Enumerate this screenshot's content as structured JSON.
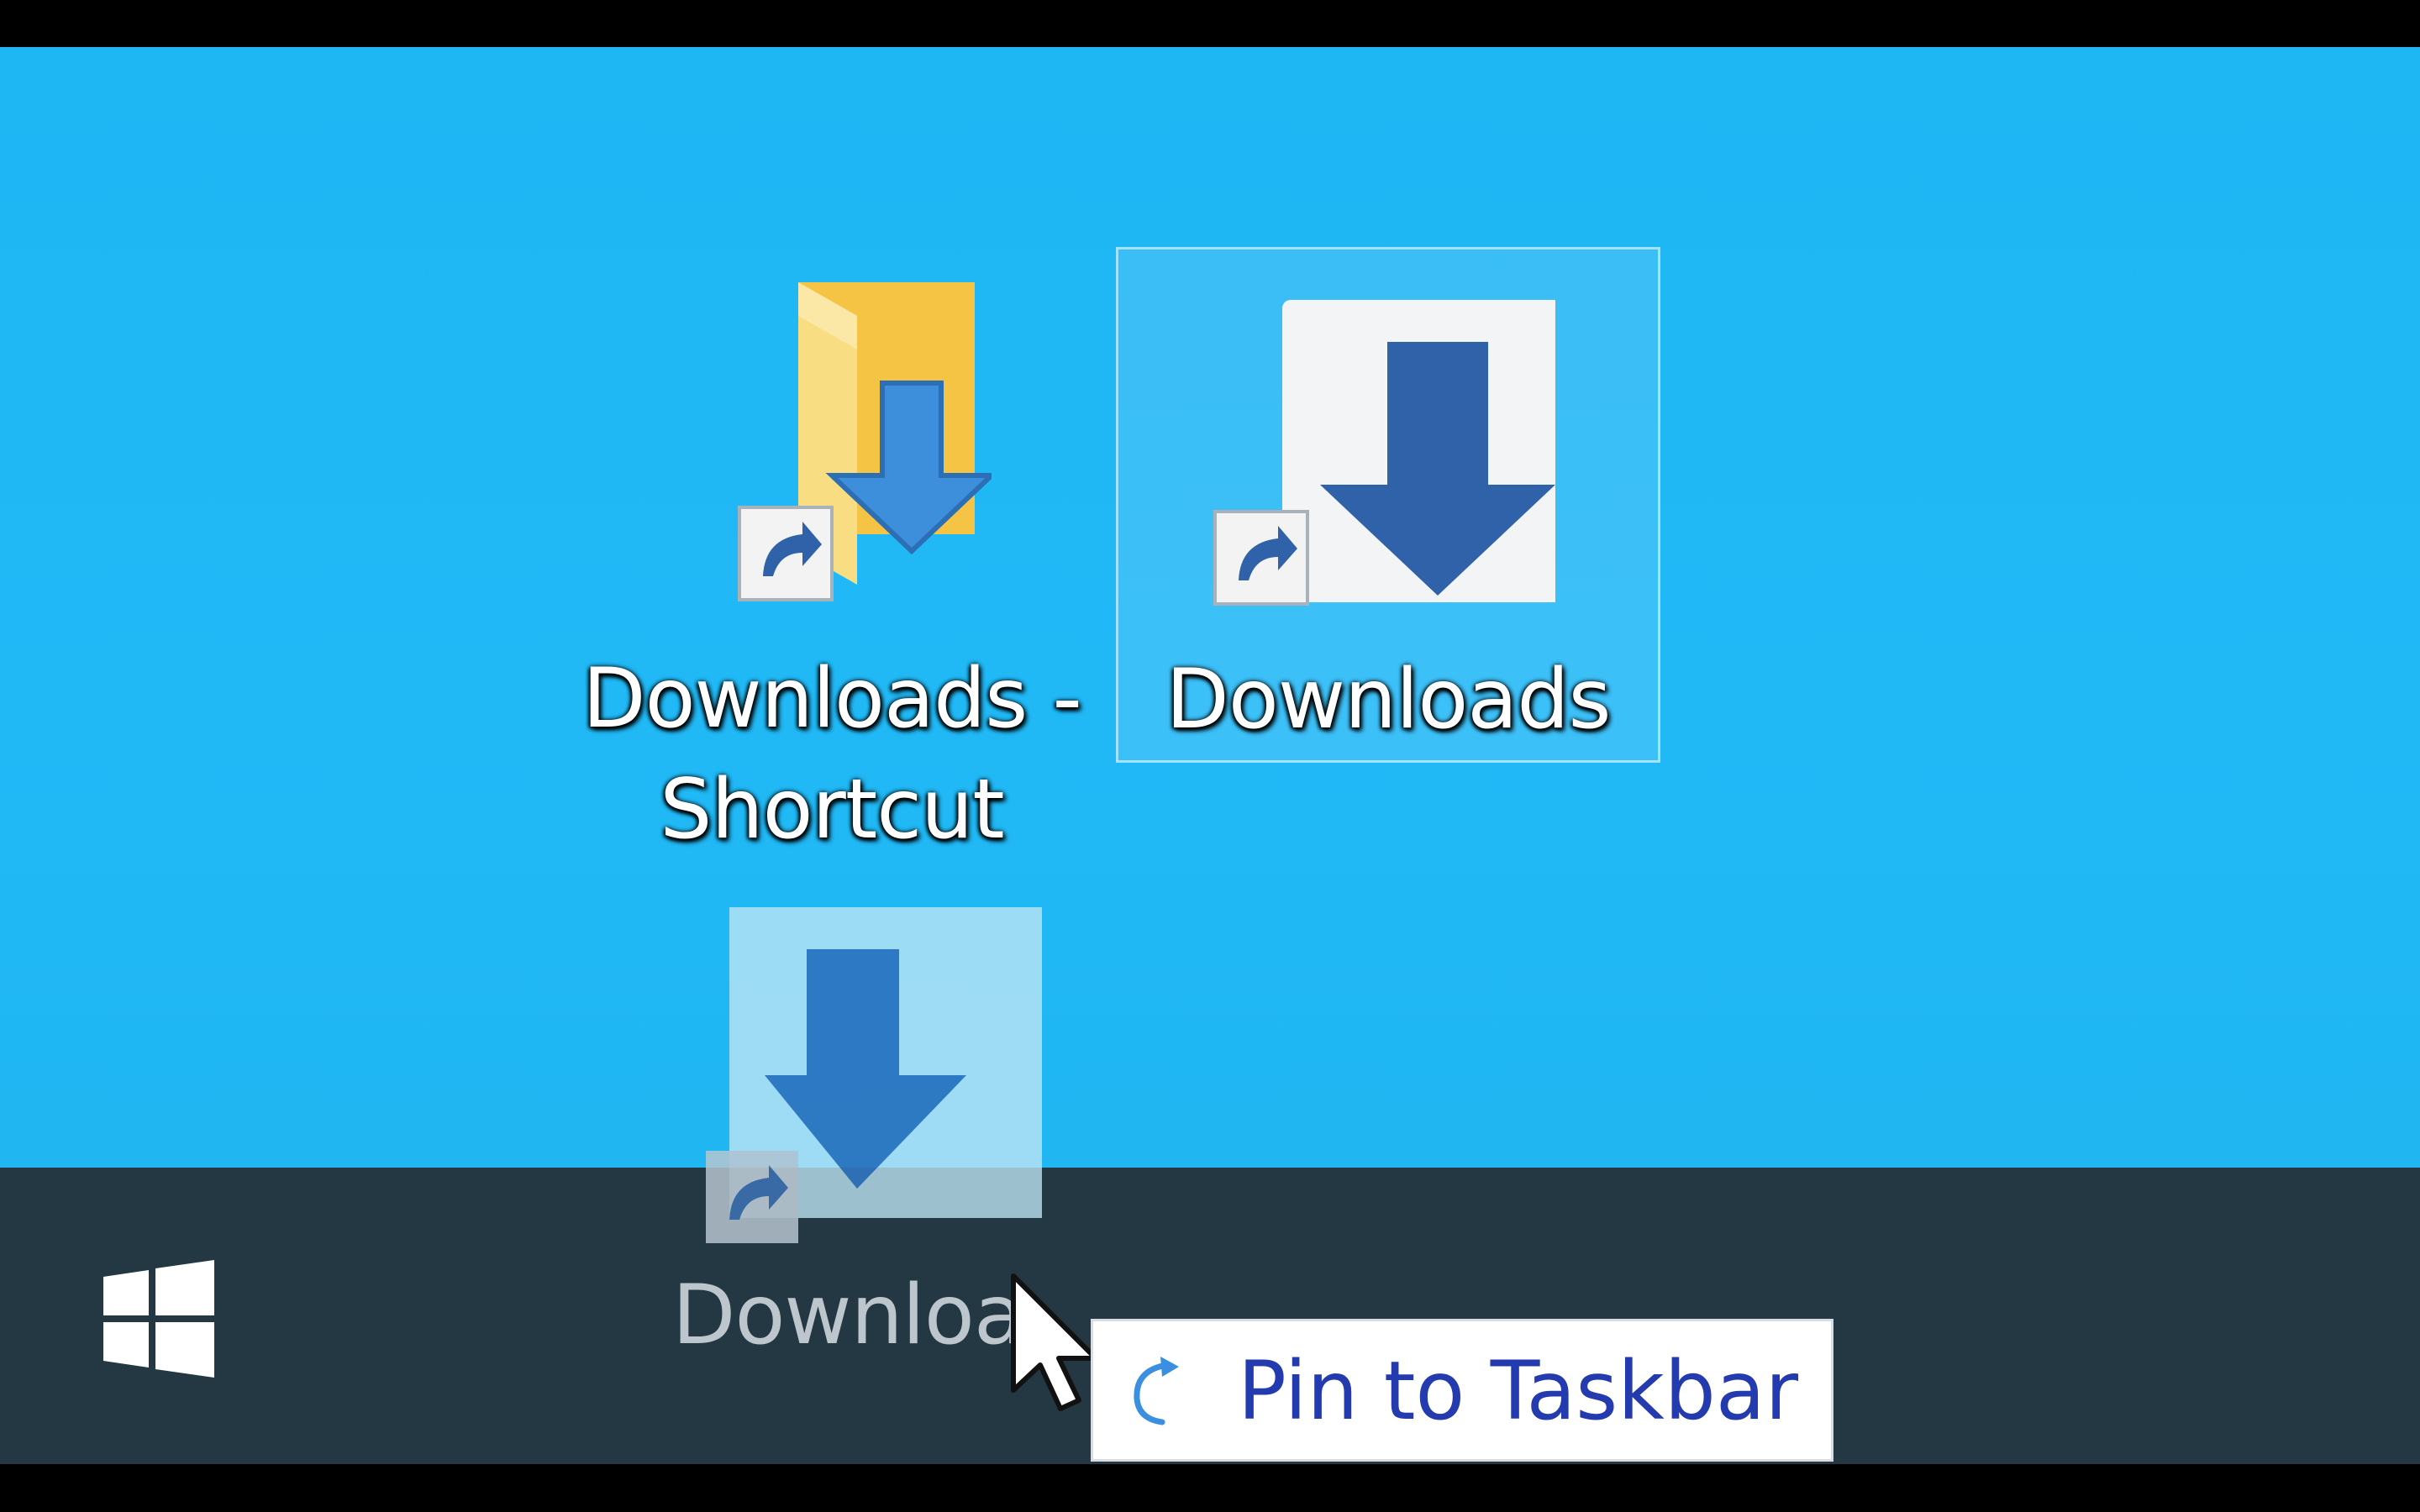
{
  "desktop": {
    "icons": [
      {
        "label_line1": "Downloads -",
        "label_line2": "Shortcut",
        "icon": "folder-download-shortcut-icon"
      },
      {
        "label": "Downloads",
        "icon": "download-arrow-shortcut-icon",
        "selected": true
      }
    ],
    "drag_ghost": {
      "label": "Downloa",
      "icon": "download-arrow-shortcut-icon"
    }
  },
  "taskbar": {
    "start_icon": "windows-logo-icon"
  },
  "tooltip": {
    "text": "Pin to Taskbar",
    "icon": "pin-arrow-icon"
  },
  "colors": {
    "desktop_bg": "#1fb7f4",
    "taskbar_bg": "#233842",
    "arrow_blue": "#2f62a8",
    "tooltip_text": "#243bb0"
  }
}
